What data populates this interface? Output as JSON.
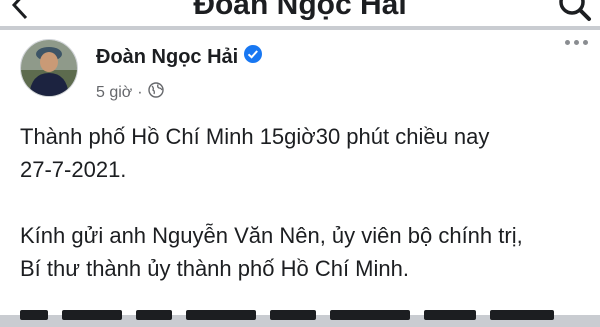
{
  "header": {
    "title": "Đoàn Ngọc Hải",
    "back_icon": "chevron-left-icon",
    "search_icon": "search-icon"
  },
  "post": {
    "author": "Đoàn Ngọc Hải",
    "verified_icon": "verified-badge-icon",
    "time": "5 giờ",
    "separator": "·",
    "privacy_icon": "globe-icon",
    "more_icon": "more-options-icon",
    "lines": [
      "Thành phố Hồ Chí Minh 15giờ30 phút chiều nay",
      "27-7-2021.",
      "",
      "Kính gửi anh Nguyễn Văn Nên, ủy viên bộ chính trị,",
      "Bí thư thành ủy thành phố Hồ Chí Minh."
    ]
  },
  "colors": {
    "text": "#1c1e21",
    "secondary": "#65676b",
    "verified": "#1877f2",
    "background": "#c9ccd1"
  }
}
